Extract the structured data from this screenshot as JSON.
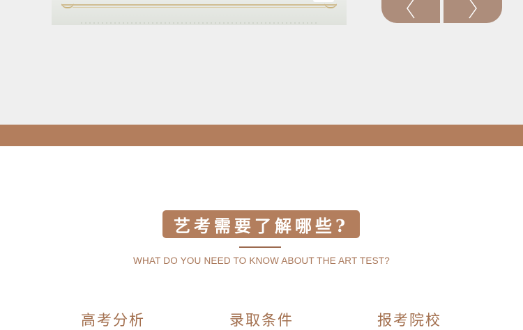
{
  "carousel": {
    "prev_icon": "chevron-left-icon",
    "next_icon": "chevron-right-icon",
    "button_color": "#ad8d7b"
  },
  "colors": {
    "top_background": "#efefef",
    "accent_brown": "#b37e5d",
    "text_brown": "#a87658"
  },
  "section": {
    "title": "艺考需要了解哪些?",
    "subtitle": "WHAT DO YOU NEED TO KNOW ABOUT THE ART TEST?",
    "categories": [
      {
        "label": "高考分析"
      },
      {
        "label": "录取条件"
      },
      {
        "label": "报考院校"
      }
    ]
  }
}
